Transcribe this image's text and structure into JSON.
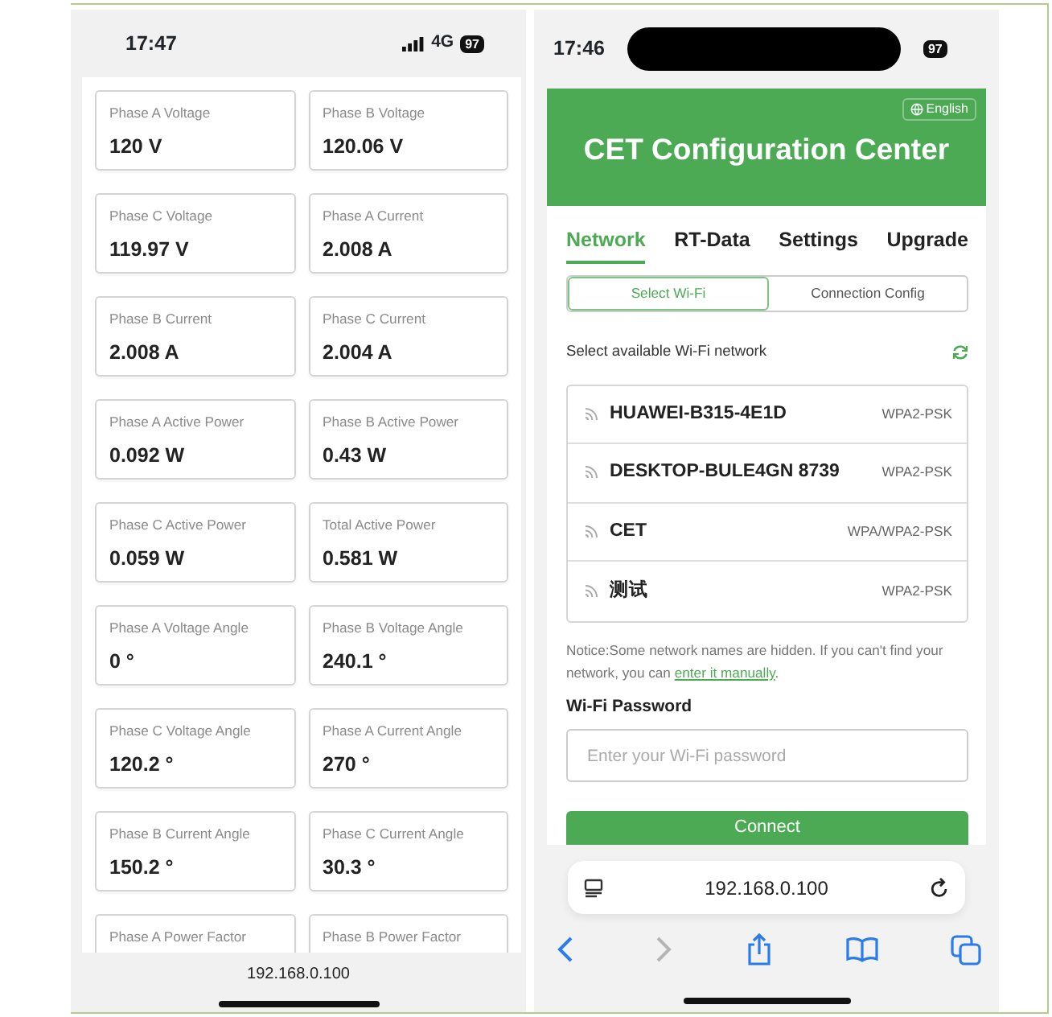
{
  "left_phone": {
    "status_bar": {
      "time": "17:47",
      "network": "4G",
      "battery": "97"
    },
    "metrics": [
      {
        "label": "Phase A Voltage",
        "value": "120 V"
      },
      {
        "label": "Phase B Voltage",
        "value": "120.06 V"
      },
      {
        "label": "Phase C Voltage",
        "value": "119.97 V"
      },
      {
        "label": "Phase A Current",
        "value": "2.008 A"
      },
      {
        "label": "Phase B Current",
        "value": "2.008 A"
      },
      {
        "label": "Phase C Current",
        "value": "2.004 A"
      },
      {
        "label": "Phase A Active Power",
        "value": "0.092 W"
      },
      {
        "label": "Phase B Active Power",
        "value": "0.43 W"
      },
      {
        "label": "Phase C Active Power",
        "value": "0.059 W"
      },
      {
        "label": "Total Active Power",
        "value": "0.581 W"
      },
      {
        "label": "Phase A Voltage Angle",
        "value": "0 °"
      },
      {
        "label": "Phase B Voltage Angle",
        "value": "240.1 °"
      },
      {
        "label": "Phase C Voltage Angle",
        "value": "120.2 °"
      },
      {
        "label": "Phase A Current Angle",
        "value": "270 °"
      },
      {
        "label": "Phase B Current Angle",
        "value": "150.2 °"
      },
      {
        "label": "Phase C Current Angle",
        "value": "30.3 °"
      },
      {
        "label": "Phase A Power Factor"
      },
      {
        "label": "Phase B Power Factor"
      }
    ],
    "address": "192.168.0.100"
  },
  "right_phone": {
    "status_bar": {
      "time": "17:46",
      "battery": "97"
    },
    "header": {
      "language": "English",
      "title": "CET Configuration Center"
    },
    "tabs": [
      {
        "label": "Network",
        "selected": true
      },
      {
        "label": "RT-Data",
        "selected": false
      },
      {
        "label": "Settings",
        "selected": false
      },
      {
        "label": "Upgrade",
        "selected": false
      }
    ],
    "subtabs": [
      {
        "label": "Select Wi-Fi",
        "selected": true
      },
      {
        "label": "Connection Config",
        "selected": false
      }
    ],
    "section_label": "Select available Wi-Fi network",
    "networks": [
      {
        "name": "HUAWEI-B315-4E1D",
        "security": "WPA2-PSK"
      },
      {
        "name": "DESKTOP-BULE4GN 8739",
        "security": "WPA2-PSK"
      },
      {
        "name": "CET",
        "security": "WPA/WPA2-PSK"
      },
      {
        "name": "测试",
        "security": "WPA2-PSK"
      }
    ],
    "notice": {
      "text": "Notice:Some network names are hidden. If you can't find your network, you can ",
      "link": "enter it manually",
      "text_after": "."
    },
    "password": {
      "label": "Wi-Fi Password",
      "placeholder": "Enter your Wi-Fi password"
    },
    "connect_button": "Connect",
    "browser": {
      "address": "192.168.0.100",
      "back_disabled": false,
      "forward_disabled": true
    }
  }
}
